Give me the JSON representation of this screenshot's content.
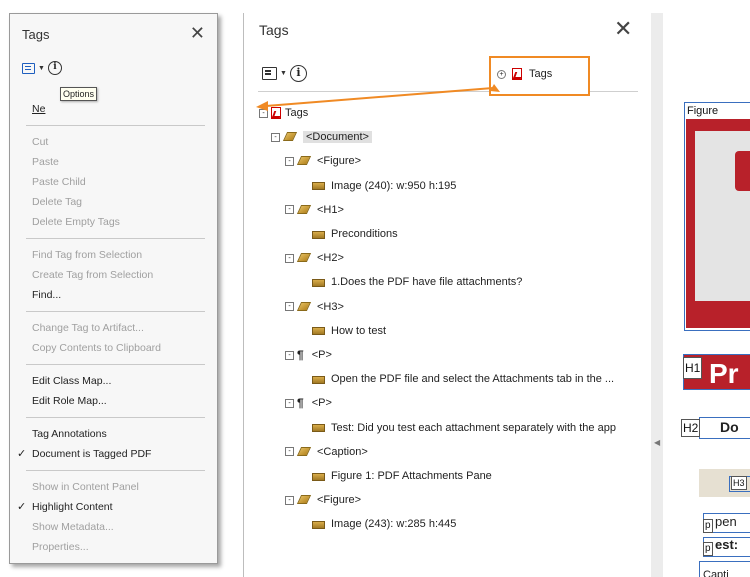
{
  "left_panel": {
    "title": "Tags",
    "tooltip": "Options",
    "menu_new_tag": "Ne",
    "menu": [
      {
        "label": "Cut",
        "enabled": false
      },
      {
        "label": "Paste",
        "enabled": false
      },
      {
        "label": "Paste Child",
        "enabled": false
      },
      {
        "label": "Delete Tag",
        "enabled": false
      },
      {
        "label": "Delete Empty Tags",
        "enabled": false
      },
      {
        "sep": true
      },
      {
        "label": "Find Tag from Selection",
        "enabled": false
      },
      {
        "label": "Create Tag from Selection",
        "enabled": false
      },
      {
        "label": "Find...",
        "enabled": true
      },
      {
        "sep": true
      },
      {
        "label": "Change Tag to Artifact...",
        "enabled": false
      },
      {
        "label": "Copy Contents to Clipboard",
        "enabled": false
      },
      {
        "sep": true
      },
      {
        "label": "Edit Class Map...",
        "enabled": true
      },
      {
        "label": "Edit Role Map...",
        "enabled": true
      },
      {
        "sep": true
      },
      {
        "label": "Tag Annotations",
        "enabled": true
      },
      {
        "label": "Document is Tagged PDF",
        "enabled": true,
        "checked": true
      },
      {
        "sep": true
      },
      {
        "label": "Show in Content Panel",
        "enabled": false
      },
      {
        "label": "Highlight Content",
        "enabled": true,
        "checked": true
      },
      {
        "label": "Show Metadata...",
        "enabled": false
      },
      {
        "label": "Properties...",
        "enabled": false
      }
    ]
  },
  "main_panel": {
    "title": "Tags",
    "callout_label": "Tags",
    "tree": [
      {
        "level": 0,
        "icon": "pdf",
        "label": "Tags",
        "expand": "-"
      },
      {
        "level": 1,
        "icon": "tag",
        "label": "<Document>",
        "expand": "-",
        "highlight": true
      },
      {
        "level": 2,
        "icon": "tag",
        "label": "<Figure>",
        "expand": "-"
      },
      {
        "level": 3,
        "icon": "box",
        "label": "Image (240): w:950 h:195"
      },
      {
        "level": 2,
        "icon": "tag",
        "label": "<H1>",
        "expand": "-"
      },
      {
        "level": 3,
        "icon": "box",
        "label": "Preconditions"
      },
      {
        "level": 2,
        "icon": "tag",
        "label": "<H2>",
        "expand": "-"
      },
      {
        "level": 3,
        "icon": "box",
        "label": "1.Does the PDF have file attachments?"
      },
      {
        "level": 2,
        "icon": "tag",
        "label": "<H3>",
        "expand": "-"
      },
      {
        "level": 3,
        "icon": "box",
        "label": "How to test"
      },
      {
        "level": 2,
        "icon": "para",
        "label": "<P>",
        "expand": "-"
      },
      {
        "level": 3,
        "icon": "box",
        "label": "Open the PDF file and select the Attachments tab in the ..."
      },
      {
        "level": 2,
        "icon": "para",
        "label": "<P>",
        "expand": "-"
      },
      {
        "level": 3,
        "icon": "box",
        "label": "Test: Did you test each attachment separately with the app"
      },
      {
        "level": 2,
        "icon": "tag",
        "label": "<Caption>",
        "expand": "-"
      },
      {
        "level": 3,
        "icon": "box",
        "label": "Figure 1: PDF Attachments Pane"
      },
      {
        "level": 2,
        "icon": "tag",
        "label": "<Figure>",
        "expand": "-"
      },
      {
        "level": 3,
        "icon": "box",
        "label": "Image (243): w:285 h:445"
      }
    ]
  },
  "doc_preview": {
    "figure_label": "Figure",
    "h1_tag": "H1",
    "h1_text": "Pr",
    "h2_tag": "H2",
    "h2_text": "Do",
    "h3_tag": "H3",
    "p1_tag": "p",
    "p1_text": "pen",
    "p2_tag": "p",
    "p2_text": "est:",
    "caption_text": "Capti"
  },
  "colors": {
    "callout": "#f08a24",
    "arrow": "#f08a24",
    "heading_red": "#b8212a",
    "tag_border_blue": "#3a6fbf"
  }
}
